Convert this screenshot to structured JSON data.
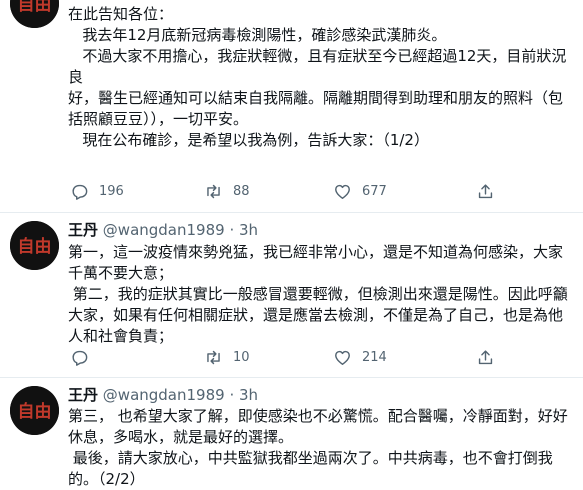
{
  "tweet1": {
    "lines": [
      "在此告知各位：",
      "",
      "   我去年12月底新冠病毒檢測陽性，確診感染武漢肺炎。",
      "",
      "   不過大家不用擔心，我症狀輕微，且有症狀至今已經超過12天，目前狀況良",
      "好，醫生已經通知可以結束自我隔離。隔離期間得到助理和朋友的照料（包",
      "括照顧豆豆）），一切平安。",
      "",
      "   現在公布確診，是希望以我為例，告訴大家：（1/2）"
    ],
    "replies": "196",
    "retweets": "88",
    "likes": "677"
  },
  "tweet2": {
    "name": "王丹",
    "meta": "@wangdan1989 · 3h",
    "lines": [
      "第一，這一波疫情來勢兇猛，我已經非常小心，還是不知道為何感染，大家",
      "千萬不要大意；",
      " 第二，我的症狀其實比一般感冒還要輕微，但檢測出來還是陽性。因此呼籲",
      "大家，如果有任何相關症狀，還是應當去檢測，不僅是為了自己，也是為他",
      "人和社會負責；"
    ],
    "replies": "",
    "retweets": "10",
    "likes": "214"
  },
  "tweet3": {
    "name": "王丹",
    "meta": "@wangdan1989 · 3h",
    "lines": [
      "第三， 也希望大家了解，即使感染也不必驚慌。配合醫囑，冷靜面對，好好",
      "休息，多喝水，就是最好的選擇。",
      " 最後，請大家放心，中共監獄我都坐過兩次了。中共病毒，也不會打倒我",
      "的。（2/2）"
    ]
  },
  "avatar_text": "自由",
  "colors": {
    "text": "#0f1419",
    "muted": "#536471",
    "divider": "#e6ecf0",
    "avatar_bg": "#111111",
    "avatar_fg": "#c0392b"
  },
  "icons": [
    "reply-icon",
    "retweet-icon",
    "like-icon",
    "share-icon"
  ]
}
